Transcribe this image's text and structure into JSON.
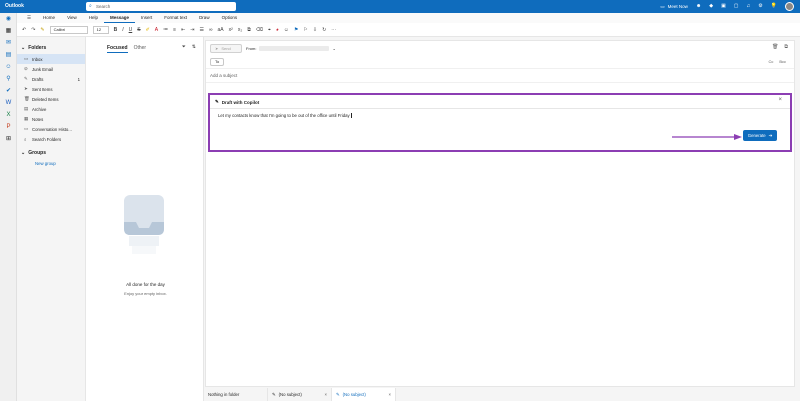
{
  "titlebar": {
    "app_title": "Outlook",
    "search_placeholder": "Search",
    "meet_now": "Meet Now",
    "icons": [
      "search-icon",
      "camera-icon",
      "people-icon",
      "diamond-icon",
      "excel-icon",
      "calendar-icon",
      "bell-icon",
      "gear-icon",
      "lightbulb-icon"
    ]
  },
  "menu": {
    "tabs": [
      "Home",
      "View",
      "Help",
      "Message",
      "Insert",
      "Format text",
      "Draw",
      "Options"
    ],
    "active": "Message"
  },
  "ribbon": {
    "font_name": "Calibri",
    "font_size": "12"
  },
  "folders": {
    "heading": "Folders",
    "items": [
      {
        "label": "Inbox",
        "icon": "inbox-icon",
        "count": ""
      },
      {
        "label": "Junk Email",
        "icon": "junk-icon",
        "count": ""
      },
      {
        "label": "Drafts",
        "icon": "pencil-icon",
        "count": "1"
      },
      {
        "label": "Sent Items",
        "icon": "send-icon",
        "count": ""
      },
      {
        "label": "Deleted Items",
        "icon": "trash-icon",
        "count": ""
      },
      {
        "label": "Archive",
        "icon": "archive-icon",
        "count": ""
      },
      {
        "label": "Notes",
        "icon": "notes-icon",
        "count": ""
      },
      {
        "label": "Conversation Histo...",
        "icon": "folder-icon",
        "count": ""
      },
      {
        "label": "Search Folders",
        "icon": "search-folder-icon",
        "count": ""
      }
    ],
    "groups_heading": "Groups",
    "new_group": "New group"
  },
  "message_list": {
    "tab_focused": "Focused",
    "tab_other": "Other",
    "empty_title": "All done for the day",
    "empty_subtitle": "Enjoy your empty inbox."
  },
  "compose": {
    "send_label": "Send",
    "from_label": "From:",
    "to_label": "To",
    "cc_label": "Cc",
    "bcc_label": "Bcc",
    "subject_placeholder": "Add a subject"
  },
  "copilot": {
    "title": "Draft with Copilot",
    "prompt": "Let my contacts know that I'm going to be out of the office until Friday",
    "generate_label": "Generate",
    "accent": "#8c3eb3"
  },
  "bottombar": {
    "tabs": [
      {
        "label": "Nothing in folder",
        "active": false
      },
      {
        "label": "(No subject)",
        "active": false
      },
      {
        "label": "(No subject)",
        "active": true
      }
    ]
  },
  "colors": {
    "brand": "#0f6cbd",
    "highlight": "#8c3eb3"
  }
}
